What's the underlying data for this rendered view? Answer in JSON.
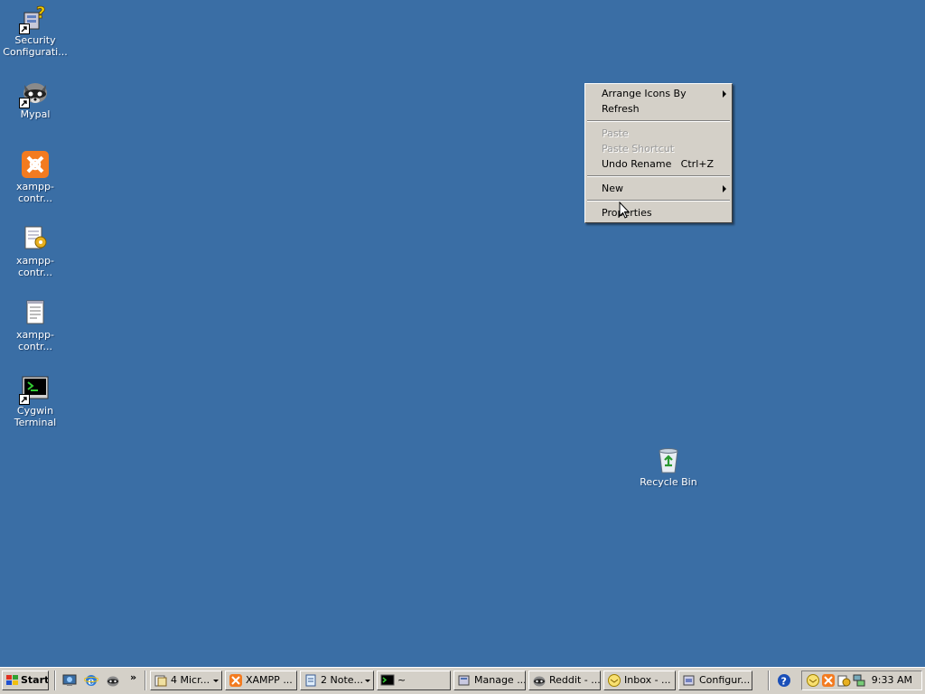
{
  "desktop": {
    "background": "#3a6ea5",
    "icons": [
      {
        "label": "Security Configurati...",
        "icon": "security-config-icon"
      },
      {
        "label": "Mypal",
        "icon": "raccoon-icon"
      },
      {
        "label": "xampp-contr...",
        "icon": "xampp-icon"
      },
      {
        "label": "xampp-contr...",
        "icon": "config-file-icon"
      },
      {
        "label": "xampp-contr...",
        "icon": "text-file-icon"
      },
      {
        "label": "Cygwin Terminal",
        "icon": "terminal-icon"
      },
      {
        "label": "Recycle Bin",
        "icon": "recycle-bin-icon"
      }
    ]
  },
  "context_menu": {
    "items": [
      {
        "label": "Arrange Icons By",
        "submenu": true,
        "disabled": false
      },
      {
        "label": "Refresh",
        "disabled": false
      },
      {
        "label": "Paste",
        "disabled": true
      },
      {
        "label": "Paste Shortcut",
        "disabled": true
      },
      {
        "label": "Undo Rename",
        "shortcut": "Ctrl+Z",
        "disabled": false
      },
      {
        "label": "New",
        "submenu": true,
        "disabled": false
      },
      {
        "label": "Properties",
        "disabled": false
      }
    ]
  },
  "taskbar": {
    "start_label": "Start",
    "quick_launch_more": "»",
    "buttons": [
      {
        "label": "4 Micr...",
        "icon": "folder-icon",
        "group": true
      },
      {
        "label": "XAMPP ...",
        "icon": "xampp-icon",
        "group": false
      },
      {
        "label": "2 Note...",
        "icon": "notepad-icon",
        "group": true
      },
      {
        "label": "~",
        "icon": "terminal-icon",
        "group": false
      },
      {
        "label": "Manage ...",
        "icon": "manage-icon",
        "group": false
      },
      {
        "label": "Reddit - ...",
        "icon": "raccoon-icon",
        "group": false
      },
      {
        "label": "Inbox - ...",
        "icon": "mail-icon",
        "group": false
      },
      {
        "label": "Configur...",
        "icon": "config-icon",
        "group": false
      }
    ],
    "clock": "9:33 AM"
  }
}
